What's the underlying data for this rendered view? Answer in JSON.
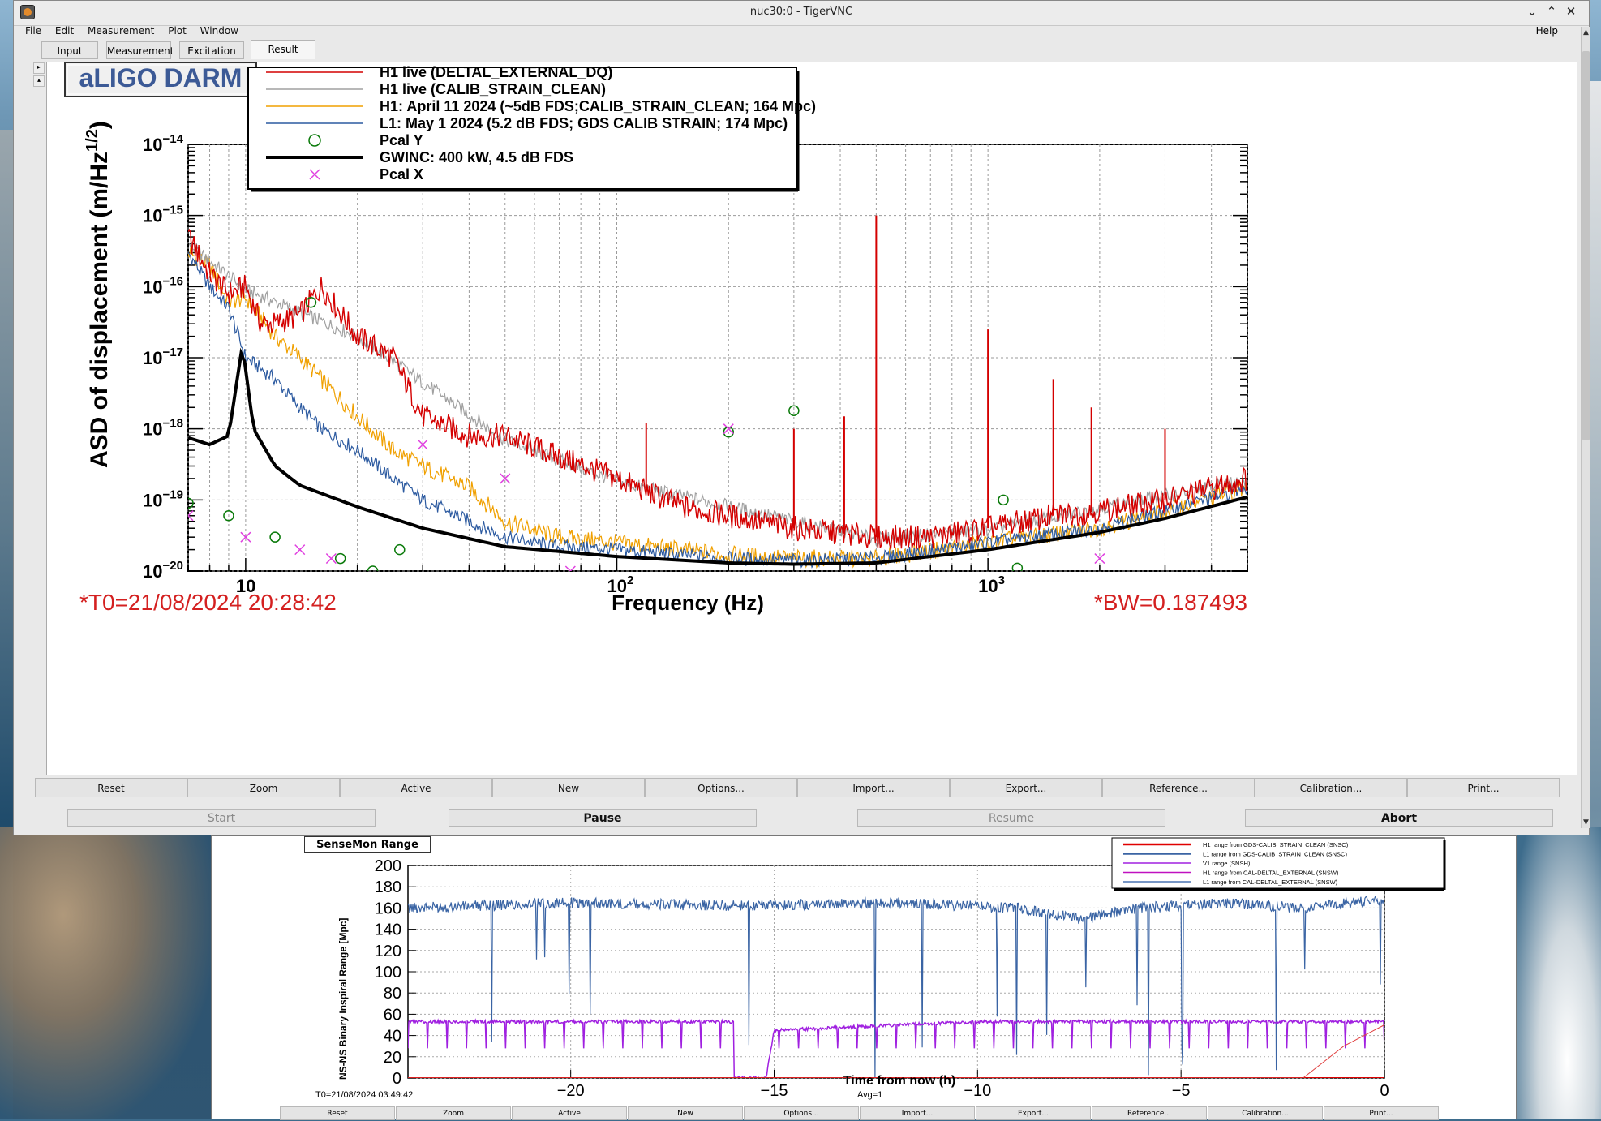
{
  "window": {
    "title": "nuc30:0 - TigerVNC",
    "controls": {
      "minimize": "⌄",
      "maximize": "⌃",
      "close": "✕"
    }
  },
  "menubar": {
    "items": [
      "File",
      "Edit",
      "Measurement",
      "Plot",
      "Window"
    ],
    "help": "Help"
  },
  "tabs": [
    "Input",
    "Measurement",
    "Excitation",
    "Result"
  ],
  "active_tab": "Result",
  "darm_plot": {
    "title_box": "aLIGO DARM",
    "ylabel": "ASD of displacement (m/Hz",
    "ylabel_sup": "1/2",
    "ylabel_close": ")",
    "xlabel": "Frequency (Hz)",
    "t0": "*T0=21/08/2024 20:28:42",
    "bw": "*BW=0.187493",
    "ytick_mantissa": "10",
    "yticks_exp": [
      "−14",
      "−15",
      "−16",
      "−17",
      "−18",
      "−19",
      "−20"
    ],
    "xticks": [
      {
        "label": "10",
        "sup": ""
      },
      {
        "label": "10",
        "sup": "2"
      },
      {
        "label": "10",
        "sup": "3"
      }
    ],
    "legend": [
      {
        "name": "H1 live (DELTAL_EXTERNAL_DQ)",
        "color": "#d40000",
        "style": "line"
      },
      {
        "name": "H1 live (CALIB_STRAIN_CLEAN)",
        "color": "#a0a0a0",
        "style": "line"
      },
      {
        "name": "H1: April 11 2024 (~5dB FDS;CALIB_STRAIN_CLEAN; 164 Mpc)",
        "color": "#f0a000",
        "style": "line"
      },
      {
        "name": "L1: May 1 2024 (5.2 dB FDS; GDS CALIB STRAIN; 174 Mpc)",
        "color": "#2c5aa0",
        "style": "line"
      },
      {
        "name": "Pcal Y",
        "color": "#0a7a0a",
        "style": "circle"
      },
      {
        "name": "GWINC: 400 kW, 4.5 dB FDS",
        "color": "#000000",
        "style": "thick"
      },
      {
        "name": "Pcal X",
        "color": "#e040e0",
        "style": "cross"
      }
    ]
  },
  "chart_data": [
    {
      "type": "line",
      "title": "aLIGO DARM",
      "xlabel": "Frequency (Hz)",
      "ylabel": "ASD of displacement (m/Hz^1/2)",
      "xscale": "log",
      "yscale": "log",
      "xlim": [
        7,
        5000
      ],
      "ylim": [
        1e-20,
        1e-14
      ],
      "grid": true,
      "legend_position": "top-center",
      "series": [
        {
          "name": "H1 live (DELTAL_EXTERNAL_DQ)",
          "x": [
            7,
            8,
            9,
            10,
            11,
            12,
            14,
            16,
            20,
            25,
            30,
            40,
            50,
            70,
            100,
            150,
            200,
            300,
            500,
            700,
            1000,
            1500,
            2000,
            3000,
            5000
          ],
          "y": [
            5e-16,
            1.5e-16,
            8e-17,
            1e-16,
            3e-17,
            3e-17,
            4e-17,
            1e-16,
            2e-17,
            1e-17,
            1.5e-18,
            8e-19,
            8e-19,
            4e-19,
            2e-19,
            8e-20,
            6e-20,
            4e-20,
            3e-20,
            3e-20,
            4e-20,
            6e-20,
            7e-20,
            1e-19,
            2e-19
          ]
        },
        {
          "name": "H1 live (CALIB_STRAIN_CLEAN)",
          "x": [
            7,
            10,
            20,
            50,
            100,
            500,
            1000,
            5000
          ],
          "y": [
            4e-16,
            9e-17,
            2e-17,
            7e-19,
            1.8e-19,
            2.8e-20,
            3.8e-20,
            1.9e-19
          ]
        },
        {
          "name": "H1: April 11 2024 (~5dB FDS;CALIB_STRAIN_CLEAN; 164 Mpc)",
          "x": [
            7,
            8,
            9,
            10,
            12,
            14,
            16,
            20,
            25,
            30,
            40,
            50,
            70,
            100,
            200,
            300,
            500,
            1000,
            2000,
            3000,
            5000
          ],
          "y": [
            3e-16,
            2e-16,
            6e-17,
            7e-17,
            2e-17,
            1e-17,
            5e-18,
            1.5e-18,
            5e-19,
            3e-19,
            1.5e-19,
            5e-20,
            3e-20,
            2.5e-20,
            1.7e-20,
            1.5e-20,
            1.5e-20,
            2.5e-20,
            4e-20,
            7e-20,
            1.5e-19
          ]
        },
        {
          "name": "L1: May 1 2024 (5.2 dB FDS; GDS CALIB STRAIN; 174 Mpc)",
          "x": [
            7,
            8,
            9,
            10,
            12,
            14,
            16,
            20,
            25,
            30,
            40,
            50,
            70,
            100,
            200,
            300,
            500,
            1000,
            2000,
            3000,
            5000
          ],
          "y": [
            3e-16,
            1e-16,
            5e-17,
            1e-17,
            5e-18,
            2e-18,
            1e-18,
            5e-19,
            2e-19,
            1e-19,
            5e-20,
            3e-20,
            2.2e-20,
            2e-20,
            1.5e-20,
            1.4e-20,
            1.5e-20,
            2.5e-20,
            4e-20,
            7e-20,
            1.5e-19
          ]
        },
        {
          "name": "GWINC: 400 kW, 4.5 dB FDS",
          "x": [
            7,
            8,
            9,
            9.8,
            10.5,
            12,
            14,
            20,
            30,
            50,
            100,
            200,
            300,
            500,
            1000,
            2000,
            3000,
            5000
          ],
          "y": [
            7.5e-19,
            6e-19,
            8e-19,
            1.5e-17,
            1e-18,
            3e-19,
            1.6e-19,
            8e-20,
            4e-20,
            2.2e-20,
            1.6e-20,
            1.3e-20,
            1.25e-20,
            1.3e-20,
            2e-20,
            3.5e-20,
            5.5e-20,
            1.1e-19
          ]
        },
        {
          "name": "Pcal Y",
          "marker": "circle",
          "x": [
            7,
            9,
            12,
            15,
            18,
            22,
            26,
            200,
            300,
            1100,
            1200
          ],
          "y": [
            9e-20,
            6e-20,
            3e-20,
            6e-17,
            1.5e-20,
            1e-20,
            2e-20,
            9e-19,
            1.8e-18,
            1e-19,
            1.1e-20
          ]
        },
        {
          "name": "Pcal X",
          "marker": "cross",
          "x": [
            7,
            10,
            14,
            17,
            30,
            50,
            75,
            200,
            2000
          ],
          "y": [
            6e-20,
            3e-20,
            2e-20,
            1.5e-20,
            6e-19,
            2e-19,
            1e-20,
            1e-18,
            1.5e-20
          ]
        }
      ]
    },
    {
      "type": "line",
      "title": "SenseMon Range",
      "xlabel": "Time from now (h)",
      "ylabel": "NS-NS Binary Inspiral Range [Mpc]",
      "xlim": [
        -24,
        0
      ],
      "ylim": [
        0,
        200
      ],
      "xticks": [
        -20,
        -15,
        -10,
        -5,
        0
      ],
      "yticks": [
        0,
        20,
        40,
        60,
        80,
        100,
        120,
        140,
        160,
        180,
        200
      ],
      "series": [
        {
          "name": "H1 range from GDS-CALIB_STRAIN_CLEAN (SNSC)",
          "x": [
            -24,
            -5,
            0
          ],
          "y": [
            0,
            0,
            0
          ]
        },
        {
          "name": "L1 range from GDS-CALIB_STRAIN_CLEAN (SNSC)",
          "x": [
            -24,
            -20,
            -16,
            -12,
            -9,
            -7.5,
            -6,
            -4,
            -2,
            0
          ],
          "y": [
            160,
            165,
            162,
            165,
            160,
            150,
            160,
            165,
            160,
            168
          ]
        },
        {
          "name": "V1 range (SNSH)",
          "x": [
            -24,
            -16,
            -16,
            -15.2,
            -15,
            -10,
            -5,
            0
          ],
          "y": [
            53,
            53,
            0,
            0,
            45,
            53,
            53,
            53
          ]
        },
        {
          "name": "H1 range from CAL-DELTAL_EXTERNAL (SNSW)",
          "x": [
            -24,
            -2,
            -1,
            0
          ],
          "y": [
            0,
            0,
            30,
            50
          ]
        },
        {
          "name": "L1 range from CAL-DELTAL_EXTERNAL (SNSW)",
          "x": [
            -9,
            -7,
            -5
          ],
          "y": [
            140,
            130,
            150
          ]
        }
      ]
    }
  ],
  "buttons": [
    "Reset",
    "Zoom",
    "Active",
    "New",
    "Options...",
    "Import...",
    "Export...",
    "Reference...",
    "Calibration...",
    "Print..."
  ],
  "controls": {
    "start": "Start",
    "pause": "Pause",
    "resume": "Resume",
    "abort": "Abort"
  },
  "range_plot": {
    "label": "SenseMon Range",
    "ylabel": "NS-NS Binary Inspiral Range [Mpc]",
    "xlabel": "Time from now (h)",
    "t0": "T0=21/08/2024 03:49:42",
    "avg": "Avg=1",
    "legend": [
      {
        "name": "H1 range from GDS-CALIB_STRAIN_CLEAN (SNSC)",
        "color": "#e00000"
      },
      {
        "name": "L1 range from GDS-CALIB_STRAIN_CLEAN (SNSC)",
        "color": "#3a64a4"
      },
      {
        "name": "V1 range (SNSH)",
        "color": "#a020e0"
      },
      {
        "name": "H1 range from CAL-DELTAL_EXTERNAL (SNSW)",
        "color": "#c010c0"
      },
      {
        "name": "L1 range from CAL-DELTAL_EXTERNAL (SNSW)",
        "color": "#4a74b4"
      }
    ],
    "yticks": [
      "0",
      "20",
      "40",
      "60",
      "80",
      "100",
      "120",
      "140",
      "160",
      "180",
      "200"
    ],
    "xticks": [
      "−20",
      "−15",
      "−10",
      "−5",
      "0"
    ],
    "buttons": [
      "Reset",
      "Zoom",
      "Active",
      "New",
      "Options...",
      "Import...",
      "Export...",
      "Reference...",
      "Calibration...",
      "Print..."
    ]
  }
}
